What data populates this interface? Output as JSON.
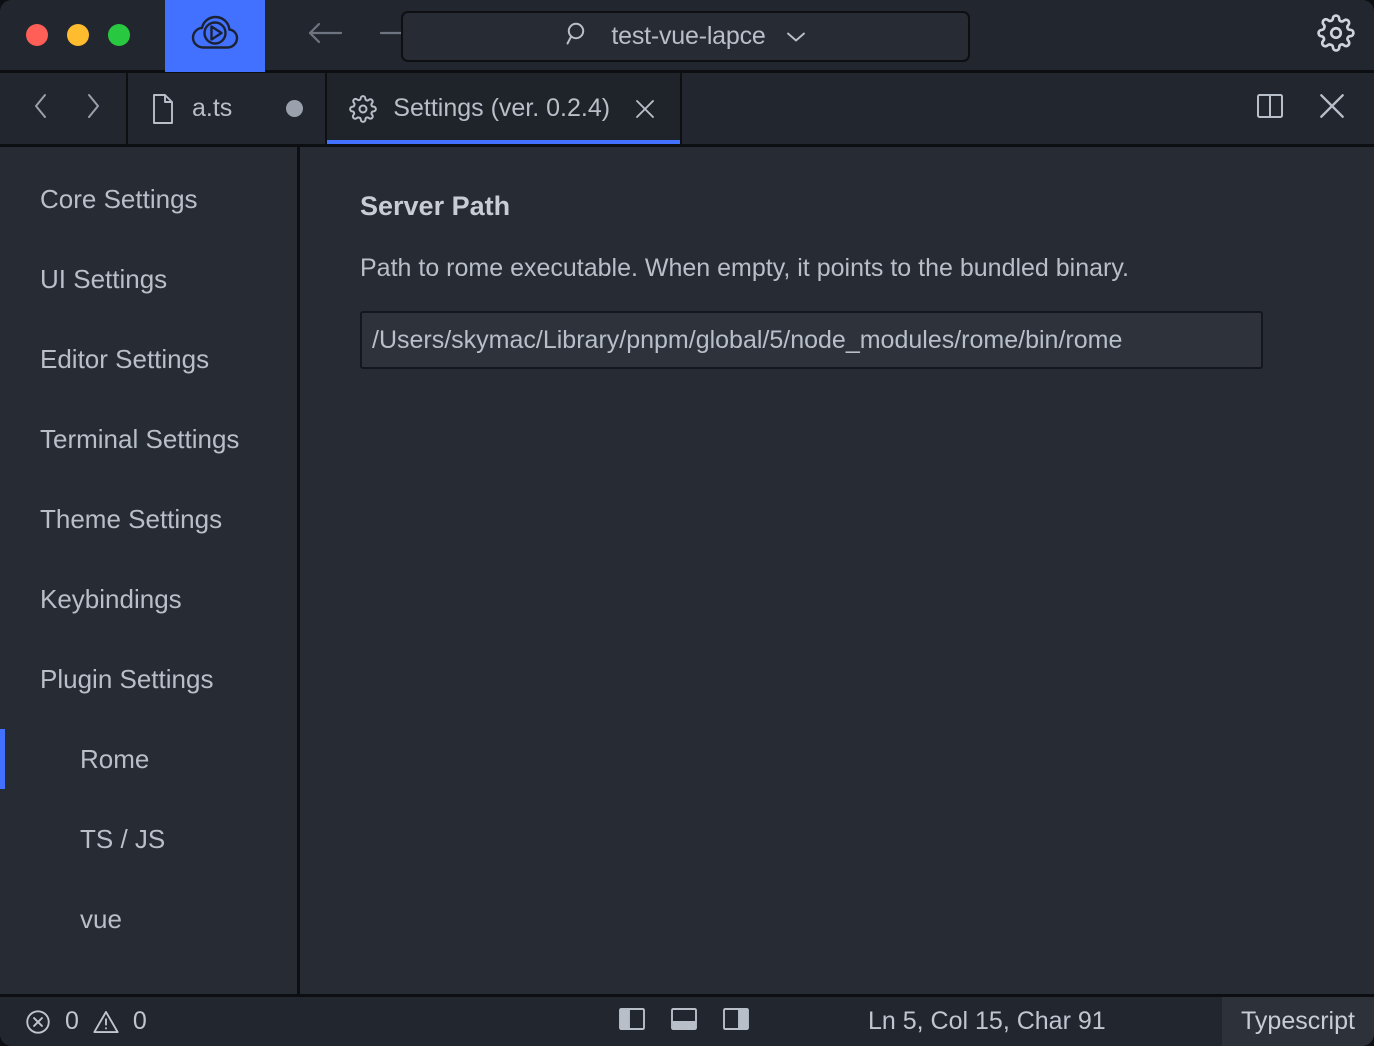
{
  "window": {
    "accent_color": "#4271ff",
    "background": "#272b33",
    "chrome_background": "#22262e"
  },
  "titlebar": {
    "traffic_lights": [
      {
        "name": "close",
        "color": "#ff5f57"
      },
      {
        "name": "minimize",
        "color": "#febc2e"
      },
      {
        "name": "maximize",
        "color": "#28c840"
      }
    ],
    "logo_icon": "cloud-play-icon",
    "back_icon": "arrow-left-icon",
    "forward_icon": "arrow-right-icon",
    "search": {
      "icon": "search-icon",
      "value": "test-vue-lapce",
      "chevron_icon": "chevron-down-icon"
    },
    "settings_icon": "gear-icon"
  },
  "tabbar": {
    "nav_back_icon": "chevron-left-icon",
    "nav_forward_icon": "chevron-right-icon",
    "tabs": [
      {
        "label": "a.ts",
        "icon": "file-icon",
        "active": false,
        "modified": true
      },
      {
        "label": "Settings (ver. 0.2.4)",
        "icon": "gear-icon",
        "active": true,
        "close_icon": "close-icon"
      }
    ],
    "split_icon": "split-editor-icon",
    "close_icon": "close-icon"
  },
  "sidebar": {
    "items": [
      {
        "label": "Core Settings",
        "active": false,
        "sub": false
      },
      {
        "label": "UI Settings",
        "active": false,
        "sub": false
      },
      {
        "label": "Editor Settings",
        "active": false,
        "sub": false
      },
      {
        "label": "Terminal Settings",
        "active": false,
        "sub": false
      },
      {
        "label": "Theme Settings",
        "active": false,
        "sub": false
      },
      {
        "label": "Keybindings",
        "active": false,
        "sub": false
      },
      {
        "label": "Plugin Settings",
        "active": false,
        "sub": false
      },
      {
        "label": "Rome",
        "active": true,
        "sub": true
      },
      {
        "label": "TS / JS",
        "active": false,
        "sub": true
      },
      {
        "label": "vue",
        "active": false,
        "sub": true
      }
    ]
  },
  "main": {
    "section_title": "Server Path",
    "section_description": "Path to rome executable. When empty, it points to the bundled binary.",
    "server_path_value": "/Users/skymac/Library/pnpm/global/5/node_modules/rome/bin/rome",
    "server_path_placeholder": ""
  },
  "statusbar": {
    "error_icon": "error-circle-icon",
    "error_count": "0",
    "warning_icon": "warning-triangle-icon",
    "warning_count": "0",
    "panel_toggles": [
      {
        "name": "toggle-left-panel",
        "icon": "panel-left-icon"
      },
      {
        "name": "toggle-bottom-panel",
        "icon": "panel-bottom-icon"
      },
      {
        "name": "toggle-right-panel",
        "icon": "panel-right-icon"
      }
    ],
    "cursor_position": "Ln 5, Col 15, Char 91",
    "language_mode": "Typescript"
  }
}
